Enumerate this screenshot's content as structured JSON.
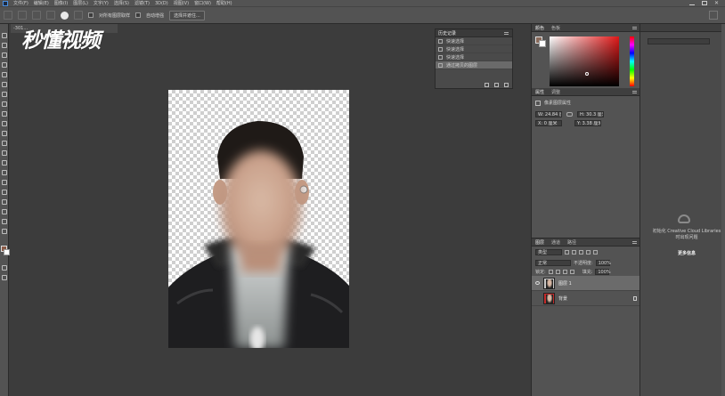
{
  "watermark": "秒懂视频",
  "menubar": {
    "items": [
      "文件(F)",
      "编辑(E)",
      "图像(I)",
      "图层(L)",
      "文字(Y)",
      "选择(S)",
      "滤镜(T)",
      "3D(D)",
      "视图(V)",
      "窗口(W)",
      "帮助(H)"
    ]
  },
  "options": {
    "sample_all_layers": "对所有图层取样",
    "auto_enhance": "自动增强",
    "select_and_mask": "选择并遮住..."
  },
  "document": {
    "tab_title": "-301..."
  },
  "history": {
    "tabs": [
      "历史记录"
    ],
    "items": [
      {
        "label": "快速选择",
        "selected": false
      },
      {
        "label": "快速选择",
        "selected": false
      },
      {
        "label": "快速选择",
        "selected": false
      },
      {
        "label": "通过拷贝的图层",
        "selected": true
      }
    ]
  },
  "color": {
    "tabs": [
      "颜色",
      "色板"
    ],
    "accent": "#e01818"
  },
  "properties": {
    "tabs": [
      "属性",
      "调整"
    ],
    "header": "像素图层属性",
    "w": "W: 24.84 厘米",
    "h": "H: 30.3 厘米",
    "x": "X: 0 厘米",
    "y": "Y: 3.38 厘米"
  },
  "layers": {
    "tabs": [
      "图层",
      "通道",
      "路径"
    ],
    "filter_kind": "类型",
    "blend_mode": "正常",
    "opacity_label": "不透明度:",
    "opacity_value": "100%",
    "lock_label": "锁定:",
    "fill_label": "填充:",
    "fill_value": "100%",
    "items": [
      {
        "name": "图层 1",
        "visible": true,
        "selected": true
      },
      {
        "name": "背景",
        "visible": false,
        "selected": false
      }
    ]
  },
  "library": {
    "message": "初始化 Creative Cloud Libraries 时出现问题",
    "link": "更多信息"
  }
}
